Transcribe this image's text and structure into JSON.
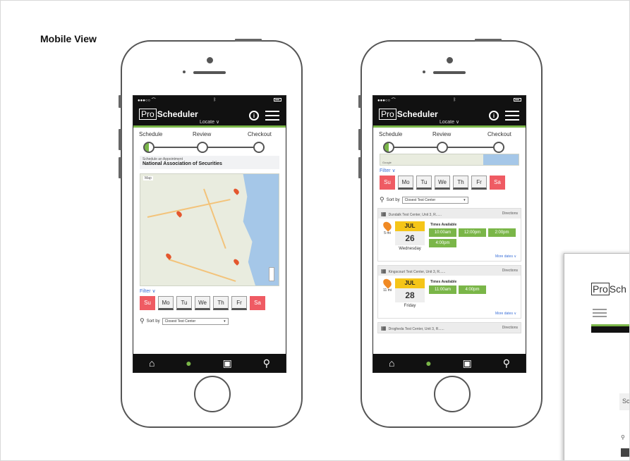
{
  "section_title": "Mobile View",
  "app": {
    "logo_pro": "Pro",
    "logo_rest": "Scheduler",
    "locate": "Locate ∨",
    "user_icon": "user-circle-icon",
    "menu_icon": "hamburger-menu-icon"
  },
  "steps": [
    "Schedule",
    "Review",
    "Checkout"
  ],
  "screen1": {
    "appt_label": "Schedule an Appointment",
    "org_name": "National Association of Securities",
    "filter": "Filter ∨",
    "days": [
      "Su",
      "Mo",
      "Tu",
      "We",
      "Th",
      "Fr",
      "Sa"
    ],
    "sort_label": "Sort by",
    "sort_value": "Closest Test Center",
    "map_tag": "Map"
  },
  "screen2": {
    "filter": "Filter ∨",
    "days": [
      "Su",
      "Mo",
      "Tu",
      "We",
      "Th",
      "Fr",
      "Sa"
    ],
    "sort_label": "Sort by",
    "sort_value": "Closest Test Center",
    "google": "Google",
    "directions": "Directions",
    "times_label": "Times Available",
    "more_dates": "More dates ∨",
    "centers": [
      {
        "name": "Dundalk Test Center, Unit 3, R......",
        "distance": "5 mi",
        "month": "JUL",
        "day": "26",
        "weekday": "Wednesday",
        "times": [
          "10:00am",
          "12:00pm",
          "2:00pm",
          "4:00pm"
        ]
      },
      {
        "name": "Kingscourt Test Center, Unit 3, R......",
        "distance": "11 mi",
        "month": "JUL",
        "day": "28",
        "weekday": "Friday",
        "times": [
          "11:00am",
          "4:00pm"
        ]
      },
      {
        "name": "Drogheda Test Center, Unit 3, R......"
      }
    ]
  },
  "nav": [
    "home-icon",
    "map-pin-icon",
    "wallet-icon",
    "search-icon"
  ],
  "panel3": {
    "logo": "Pro",
    "logo_rest": "Sch",
    "input": "Sc"
  },
  "colors": {
    "accent_green": "#7ab648",
    "day_red": "#ef5b63",
    "month_yellow": "#f5c518",
    "link_blue": "#3a6fd8",
    "header_black": "#111111"
  }
}
